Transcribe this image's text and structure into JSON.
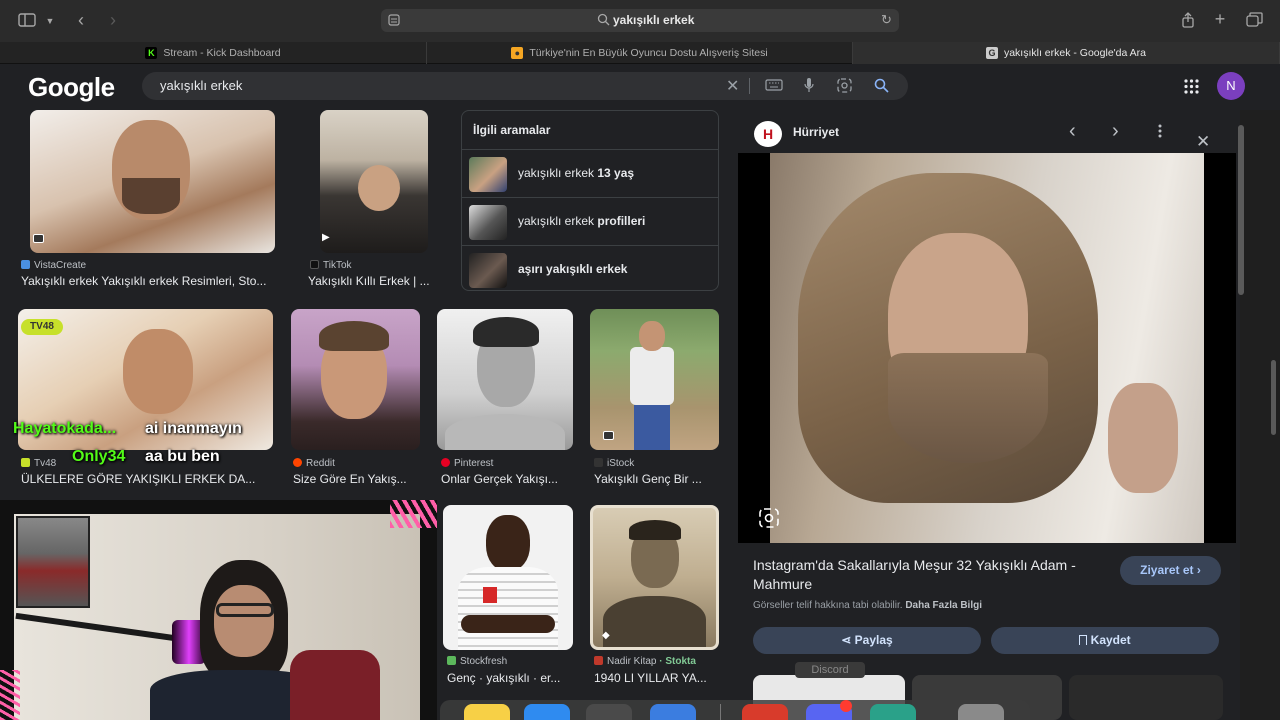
{
  "browser": {
    "address": "yakışıklı erkek",
    "tabs": [
      {
        "label": "Stream - Kick Dashboard",
        "icon": "K",
        "color": "#53fc18"
      },
      {
        "label": "Türkiye'nin En Büyük Oyuncu Dostu Alışveriş Sitesi",
        "icon": "bag",
        "color": "#f5a623"
      },
      {
        "label": "yakışıklı erkek - Google'da Ara",
        "icon": "G",
        "color": "#cccccc"
      }
    ]
  },
  "google": {
    "logo": "Google",
    "query": "yakışıklı erkek",
    "avatar_letter": "N"
  },
  "results": [
    {
      "source": "VistaCreate",
      "caption": "Yakışıklı erkek Yakışıklı erkek Resimleri, Sto...",
      "src_color": "#4a90e2"
    },
    {
      "source": "TikTok",
      "caption": "Yakışıklı Kıllı Erkek | ...",
      "src_color": "#111111"
    },
    {
      "source": "Tv48",
      "caption": "ÜLKELERE GÖRE YAKIŞIKLI ERKEK DA...",
      "src_color": "#c7e02a"
    },
    {
      "source": "Reddit",
      "caption": "Size Göre En Yakış...",
      "src_color": "#ff4500"
    },
    {
      "source": "Pinterest",
      "caption": "Onlar Gerçek Yakışı...",
      "src_color": "#e60023"
    },
    {
      "source": "iStock",
      "caption": "Yakışıklı Genç Bir ...",
      "src_color": "#333333"
    },
    {
      "source": "Stockfresh",
      "caption": "Genç · yakışıklı · er...",
      "src_color": "#5cb85c"
    },
    {
      "source": "Nadir Kitap",
      "source_extra": "· Stokta",
      "caption": "1940 LI YILLAR YA...",
      "src_color": "#c0392b"
    }
  ],
  "related": {
    "heading": "İlgili aramalar",
    "items": [
      {
        "prefix": "yakışıklı erkek",
        "bold": "13 yaş"
      },
      {
        "prefix": "yakışıklı erkek",
        "bold": "profilleri"
      },
      {
        "prefix": "",
        "bold": "aşırı yakışıklı erkek"
      }
    ]
  },
  "overlays": {
    "line1_user": "Hayatokada...",
    "line1_msg": "ai inanmayın",
    "line2_user": "Only34",
    "line2_msg": "aa bu ben"
  },
  "panel": {
    "site": "Hürriyet",
    "site_icon": "H",
    "title": "Instagram'da Sakallarıyla Meşur 32 Yakışıklı Adam - Mahmure",
    "visit_label": "Ziyaret et",
    "copyright_prefix": "Görseller telif hakkına tabi olabilir.",
    "copyright_link": "Daha Fazla Bilgi",
    "share_label": "Paylaş",
    "save_label": "Kaydet"
  },
  "dock": {
    "tooltip": "Discord"
  }
}
